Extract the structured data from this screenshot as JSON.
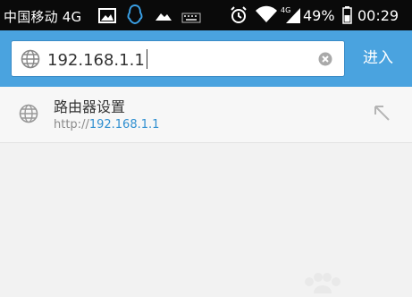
{
  "status_bar": {
    "carrier": "中国移动 4G",
    "signal_label": "4G",
    "battery": "49%",
    "time": "00:29",
    "icons": [
      "image-icon",
      "qq-icon",
      "cloud-icon",
      "keyboard-icon",
      "alarm-icon",
      "wifi-icon",
      "signal-icon",
      "battery-icon"
    ]
  },
  "browser": {
    "address_value": "192.168.1.1",
    "go_label": "进入"
  },
  "suggestion": {
    "title": "路由器设置",
    "url_prefix": "http://",
    "url_host": "192.168.1.1"
  },
  "colors": {
    "toolbar": "#4aa3df",
    "link": "#2f8fd0",
    "statusbar": "#0a0a0a"
  }
}
